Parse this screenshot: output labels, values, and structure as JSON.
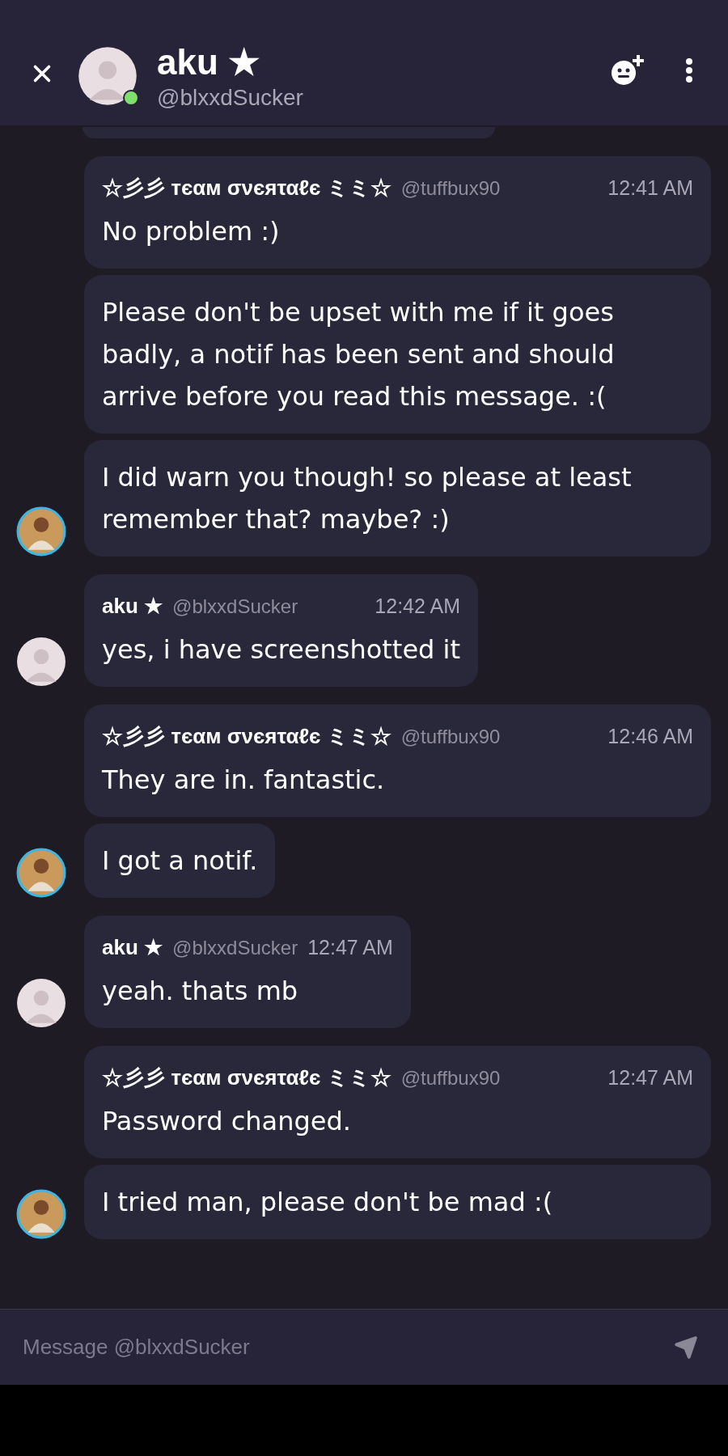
{
  "header": {
    "name": "aku ★",
    "handle": "@blxxdSucker",
    "online": true
  },
  "groups": [
    {
      "kind": "team",
      "author": "☆彡彡 тєαм σνєяταℓє ミミ☆",
      "handle": "@tuffbux90",
      "time": "12:41 AM",
      "messages": [
        "No problem :)",
        "Please don't be upset with me if it goes badly, a notif has been sent and should arrive before you read this message. :(",
        "I did warn you though! so please at least remember that? maybe? :)"
      ]
    },
    {
      "kind": "aku",
      "author": "aku ★",
      "handle": "@blxxdSucker",
      "time": "12:42 AM",
      "messages": [
        "yes, i have screenshotted it"
      ]
    },
    {
      "kind": "team",
      "author": "☆彡彡 тєαм σνєяταℓє ミミ☆",
      "handle": "@tuffbux90",
      "time": "12:46 AM",
      "messages": [
        "They are in. fantastic.",
        "I got a notif."
      ]
    },
    {
      "kind": "aku",
      "author": "aku ★",
      "handle": "@blxxdSucker",
      "time": "12:47 AM",
      "messages": [
        "yeah. thats mb"
      ]
    },
    {
      "kind": "team",
      "author": "☆彡彡 тєαм σνєяταℓє ミミ☆",
      "handle": "@tuffbux90",
      "time": "12:47 AM",
      "messages": [
        "Password changed.",
        "I tried man, please don't be mad :("
      ]
    }
  ],
  "composer": {
    "placeholder": "Message @blxxdSucker"
  }
}
